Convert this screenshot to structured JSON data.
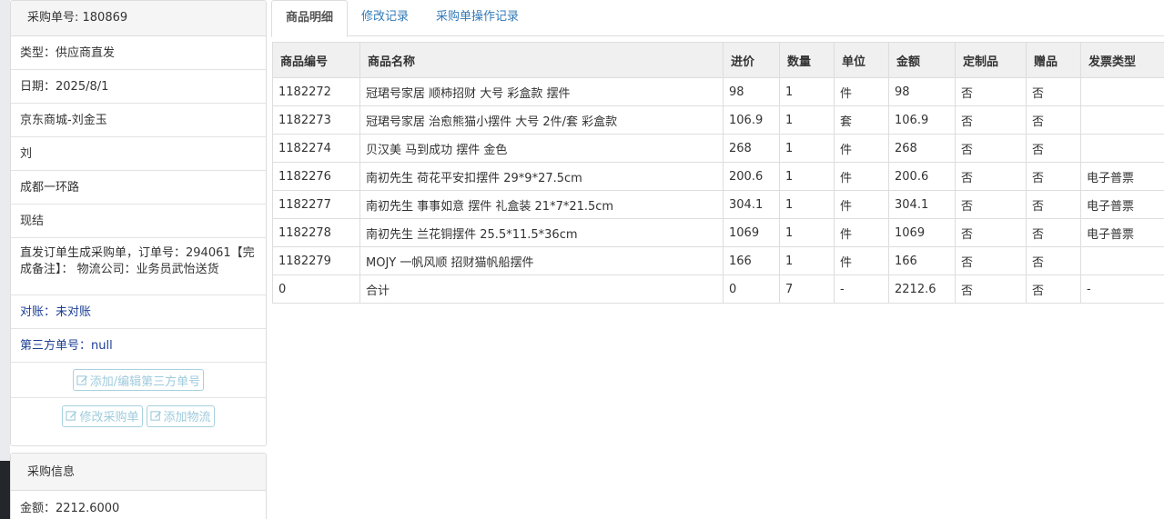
{
  "sidebar": {
    "header": "采购单号: 180869",
    "rows": [
      "类型：供应商直发",
      "日期：2025/8/1",
      "京东商城-刘金玉",
      "刘",
      "成都一环路",
      "现结"
    ],
    "note": "直发订单生成采购单，订单号：294061【完成备注】： 物流公司：业务员武怡送货",
    "reconcile": "对账：未对账",
    "third_party_no": "第三方单号：null",
    "btn_third_party": "添加/编辑第三方单号",
    "btn_edit_order": "修改采购单",
    "btn_add_logistics": "添加物流",
    "info_header": "采购信息",
    "amount": "金额：2212.6000"
  },
  "tabs": [
    {
      "label": "商品明细",
      "active": true
    },
    {
      "label": "修改记录",
      "active": false
    },
    {
      "label": "采购单操作记录",
      "active": false
    }
  ],
  "table": {
    "headers": [
      "商品编号",
      "商品名称",
      "进价",
      "数量",
      "单位",
      "金额",
      "定制品",
      "赠品",
      "发票类型"
    ],
    "rows": [
      [
        "1182272",
        "冠珺号家居 顺柿招财 大号 彩盒款 摆件",
        "98",
        "1",
        "件",
        "98",
        "否",
        "否",
        ""
      ],
      [
        "1182273",
        "冠珺号家居 治愈熊猫小摆件 大号 2件/套 彩盒款",
        "106.9",
        "1",
        "套",
        "106.9",
        "否",
        "否",
        ""
      ],
      [
        "1182274",
        "贝汉美 马到成功 摆件 金色",
        "268",
        "1",
        "件",
        "268",
        "否",
        "否",
        ""
      ],
      [
        "1182276",
        "南初先生 荷花平安扣摆件 29*9*27.5cm",
        "200.6",
        "1",
        "件",
        "200.6",
        "否",
        "否",
        "电子普票"
      ],
      [
        "1182277",
        "南初先生 事事如意 摆件 礼盒装 21*7*21.5cm",
        "304.1",
        "1",
        "件",
        "304.1",
        "否",
        "否",
        "电子普票"
      ],
      [
        "1182278",
        "南初先生 兰花铜摆件 25.5*11.5*36cm",
        "1069",
        "1",
        "件",
        "1069",
        "否",
        "否",
        "电子普票"
      ],
      [
        "1182279",
        "MOJY 一帆风顺 招财猫帆船摆件",
        "166",
        "1",
        "件",
        "166",
        "否",
        "否",
        ""
      ],
      [
        "0",
        "合计",
        "0",
        "7",
        "-",
        "2212.6",
        "否",
        "否",
        "-"
      ]
    ]
  },
  "colors": {
    "link_blue": "#337ab7",
    "reconcile_blue": "#1c3f94",
    "button_border": "#a8d0de",
    "header_bg": "#f0f0f0"
  }
}
